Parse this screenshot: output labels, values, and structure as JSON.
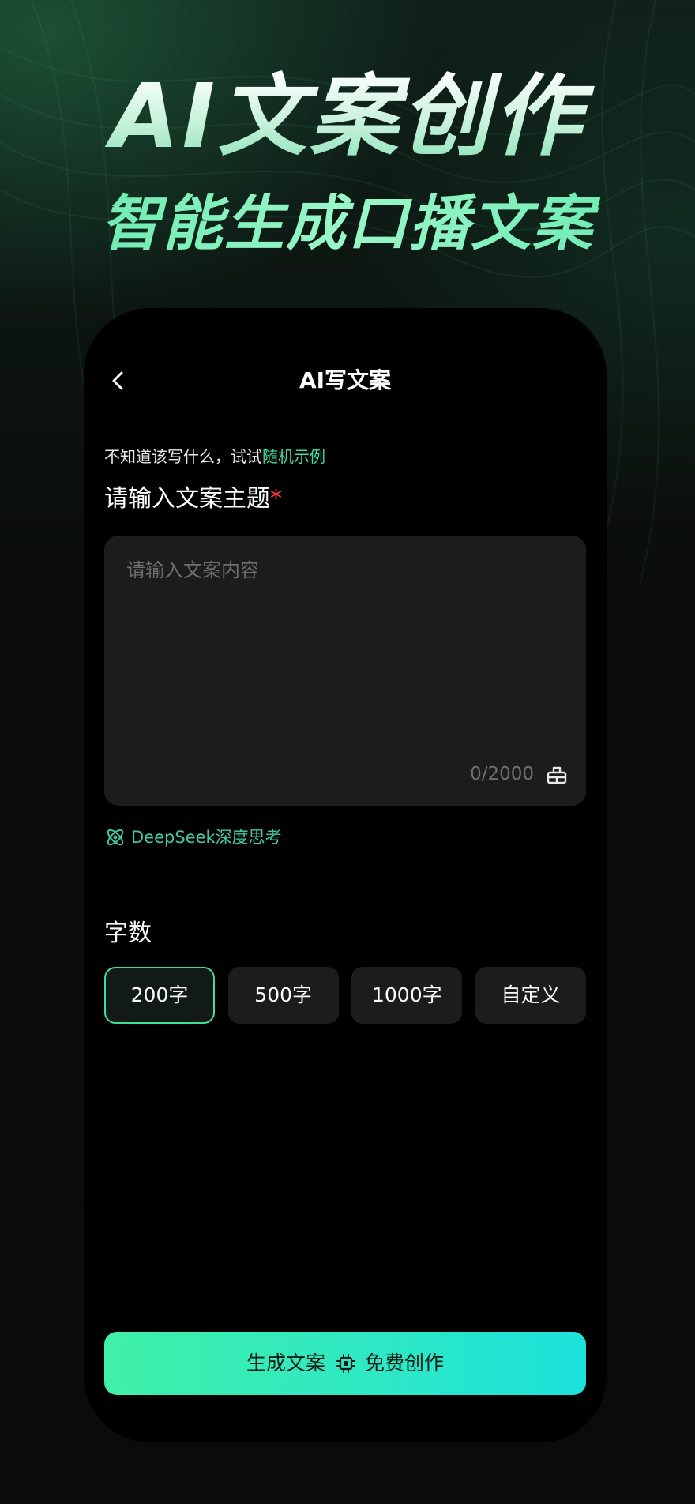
{
  "hero": {
    "title": "AI文案创作",
    "subtitle": "智能生成口播文案"
  },
  "nav": {
    "title": "AI写文案",
    "back_icon": "chevron-left-icon"
  },
  "form": {
    "hint_prefix": "不知道该写什么，试试",
    "hint_link": "随机示例",
    "topic_label": "请输入文案主题",
    "required_mark": "*",
    "topic_value": "",
    "topic_placeholder": "请输入文案内容",
    "char_counter": "0/2000",
    "clear_icon": "eraser-icon",
    "deepseek_icon": "atom-icon",
    "deepseek_label": "DeepSeek深度思考"
  },
  "word_count": {
    "label": "字数",
    "options": [
      "200字",
      "500字",
      "1000字",
      "自定义"
    ],
    "selected": "200字"
  },
  "cta": {
    "generate_label": "生成文案",
    "chip_icon": "chip-icon",
    "free_label": "免费创作"
  },
  "colors": {
    "accent": "#3fdc9a",
    "deepseek": "#3fc9a8",
    "required": "#ff3b3b",
    "cta_start": "#3ff0a8",
    "cta_end": "#1ce2dc",
    "input_bg": "#1c1c1c"
  }
}
